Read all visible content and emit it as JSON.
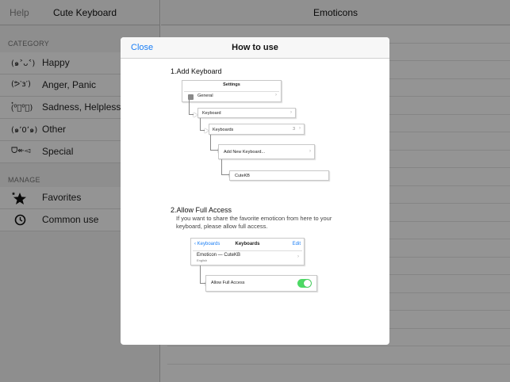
{
  "sidebar": {
    "help_label": "Help",
    "title": "Cute Keyboard",
    "category_header": "CATEGORY",
    "categories": [
      {
        "emoticon": "(๑˃ᴗ˂)",
        "label": "Happy"
      },
      {
        "emoticon": "(ᕗ‵з′)",
        "label": "Anger, Panic"
      },
      {
        "emoticon": "(๋⁰﹏⁰๋)",
        "label": "Sadness, Helplessness"
      },
      {
        "emoticon": "(๑ʼ0ʼ๑)",
        "label": "Other"
      },
      {
        "emoticon": "ᗜ↞◅",
        "label": "Special"
      }
    ],
    "manage_header": "MANAGE",
    "manage_items": [
      {
        "icon": "favorites-icon",
        "label": "Favorites"
      },
      {
        "icon": "clock-icon",
        "label": "Common use"
      }
    ]
  },
  "main": {
    "title": "Emoticons"
  },
  "modal": {
    "close_label": "Close",
    "title": "How to use",
    "step1_title": "1.Add Keyboard",
    "settings_title": "Settings",
    "general_label": "General",
    "keyboard_label": "Keyboard",
    "keyboards_label": "Keyboards",
    "keyboards_count": "3",
    "add_new_label": "Add New Keyboard...",
    "cutekb_label": "CuteKB",
    "step2_title": "2.Allow Full Access",
    "step2_desc": "If you want to share the favorite emoticon from here to your keyboard, please allow full access.",
    "kb_back": "Keyboards",
    "kb_title": "Keyboards",
    "kb_edit": "Edit",
    "kb_entry": "Emoticon — CuteKB",
    "kb_entry_sub": "English",
    "full_access_label": "Allow Full Access",
    "full_access_on": true
  },
  "colors": {
    "accent": "#1a7ef5",
    "toggle_on": "#4cd964"
  }
}
